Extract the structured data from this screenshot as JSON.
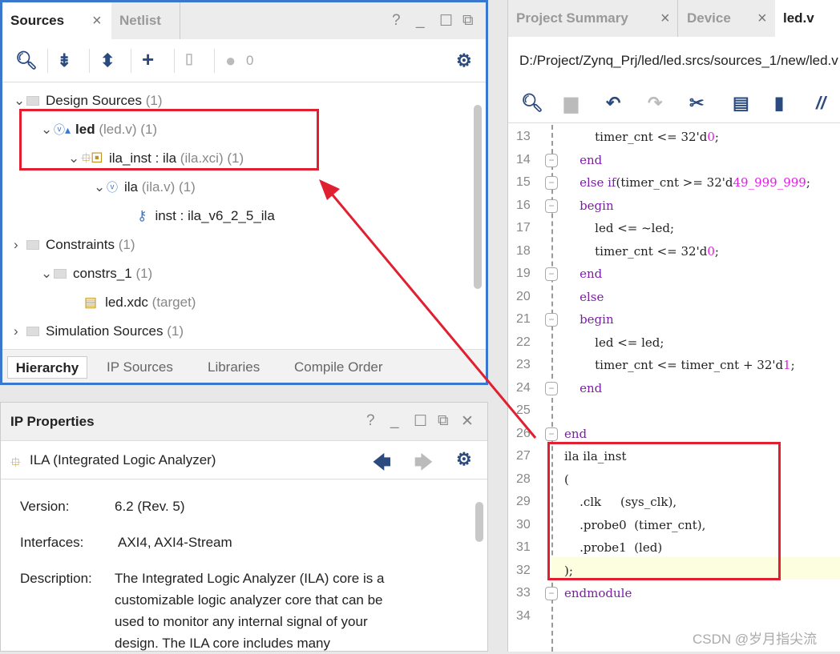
{
  "sources_panel": {
    "tabs": [
      {
        "label": "Sources",
        "active": true
      },
      {
        "label": "Netlist",
        "active": false
      }
    ],
    "window_icons": [
      "help-icon",
      "minimize-icon",
      "maximize-icon",
      "float-icon"
    ],
    "toolbar": {
      "error_count": "0"
    },
    "tree": [
      {
        "label": "Design Sources",
        "meta": "(1)",
        "level": 0,
        "bold": false
      },
      {
        "label": "led",
        "meta": "(led.v) (1)",
        "level": 1,
        "bold": true
      },
      {
        "label": "ila_inst : ila",
        "meta": "(ila.xci) (1)",
        "level": 2,
        "bold": false
      },
      {
        "label": "ila",
        "meta": "(ila.v) (1)",
        "level": 3,
        "bold": false
      },
      {
        "label": "inst : ila_v6_2_5_ila",
        "meta": "",
        "level": 4,
        "bold": false
      },
      {
        "label": "Constraints",
        "meta": "(1)",
        "level": 0,
        "bold": false
      },
      {
        "label": "constrs_1",
        "meta": "(1)",
        "level": 1,
        "bold": false
      },
      {
        "label": "led.xdc",
        "meta": "(target)",
        "level": 2,
        "bold": false
      },
      {
        "label": "Simulation Sources",
        "meta": "(1)",
        "level": 0,
        "bold": false
      }
    ],
    "bottom_tabs": [
      "Hierarchy",
      "IP Sources",
      "Libraries",
      "Compile Order"
    ]
  },
  "ip_properties": {
    "title": "IP Properties",
    "ip_name": "ILA (Integrated Logic Analyzer)",
    "version_label": "Version:",
    "version": "6.2 (Rev. 5)",
    "interfaces_label": "Interfaces:",
    "interfaces": "AXI4, AXI4-Stream",
    "description_label": "Description:",
    "description_lines": [
      "The Integrated Logic Analyzer (ILA) core is a",
      "customizable logic analyzer core that can be",
      "used to monitor any internal signal of your",
      "design. The ILA core includes many"
    ]
  },
  "editor": {
    "tabs": [
      {
        "label": "Project Summary"
      },
      {
        "label": "Device"
      },
      {
        "label": "led.v",
        "active": true
      }
    ],
    "path": "D:/Project/Zynq_Prj/led/led.srcs/sources_1/new/led.v",
    "lines": [
      {
        "n": "13",
        "t": "        timer_cnt <= 32'd",
        "num": "0",
        ";": ";"
      },
      {
        "n": "14",
        "t": "    end"
      },
      {
        "n": "15",
        "t": "    else if(timer_cnt >= 32'd",
        "num": "49_999_999"
      },
      {
        "n": "16",
        "t": "    begin"
      },
      {
        "n": "17",
        "t": "        led <= ~led;"
      },
      {
        "n": "18",
        "t": "        timer_cnt <= 32'd",
        "num": "0"
      },
      {
        "n": "19",
        "t": "    end"
      },
      {
        "n": "20",
        "t": "    else"
      },
      {
        "n": "21",
        "t": "    begin"
      },
      {
        "n": "22",
        "t": "        led <= led;"
      },
      {
        "n": "23",
        "t": "        timer_cnt <= timer_cnt + 32'd",
        "num": "1"
      },
      {
        "n": "24",
        "t": "    end"
      },
      {
        "n": "25",
        "t": ""
      },
      {
        "n": "26",
        "t": "end"
      },
      {
        "n": "27",
        "t": "ila ila_inst"
      },
      {
        "n": "28",
        "t": "("
      },
      {
        "n": "29",
        "t": "    .clk     (sys_clk),"
      },
      {
        "n": "30",
        "t": "    .probe0  (timer_cnt),"
      },
      {
        "n": "31",
        "t": "    .probe1  (led)"
      },
      {
        "n": "32",
        "t": ");"
      },
      {
        "n": "33",
        "t": "endmodule"
      },
      {
        "n": "34",
        "t": ""
      }
    ]
  },
  "watermark": "CSDN @岁月指尖流",
  "colors": {
    "accent": "#3a78d0",
    "annotation": "#e02030",
    "keyword": "#7a1fa2",
    "number": "#e020e0",
    "icon": "#2b4b7e"
  }
}
